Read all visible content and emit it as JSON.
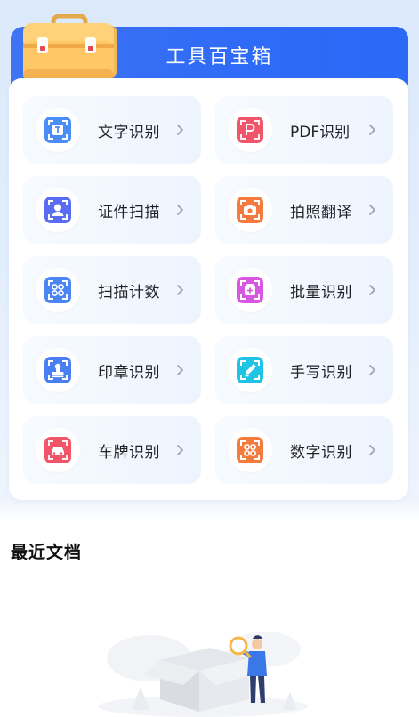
{
  "header": {
    "title": "工具百宝箱"
  },
  "tools": [
    {
      "label": "文字识别",
      "icon": "text-recognition-icon",
      "color": "#4a8df6"
    },
    {
      "label": "PDF识别",
      "icon": "pdf-recognition-icon",
      "color": "#f0556a"
    },
    {
      "label": "证件扫描",
      "icon": "id-scan-icon",
      "color": "#5a6cf2"
    },
    {
      "label": "拍照翻译",
      "icon": "photo-translate-icon",
      "color": "#f57a3f"
    },
    {
      "label": "扫描计数",
      "icon": "scan-count-icon",
      "color": "#4b86f5"
    },
    {
      "label": "批量识别",
      "icon": "batch-recognition-icon",
      "color": "#d857e0"
    },
    {
      "label": "印章识别",
      "icon": "seal-recognition-icon",
      "color": "#4a7ff2"
    },
    {
      "label": "手写识别",
      "icon": "handwriting-recognition-icon",
      "color": "#1fc3e6"
    },
    {
      "label": "车牌识别",
      "icon": "license-plate-icon",
      "color": "#f2546a"
    },
    {
      "label": "数字识别",
      "icon": "number-recognition-icon",
      "color": "#f47b3e"
    }
  ],
  "recent": {
    "title": "最近文档"
  }
}
